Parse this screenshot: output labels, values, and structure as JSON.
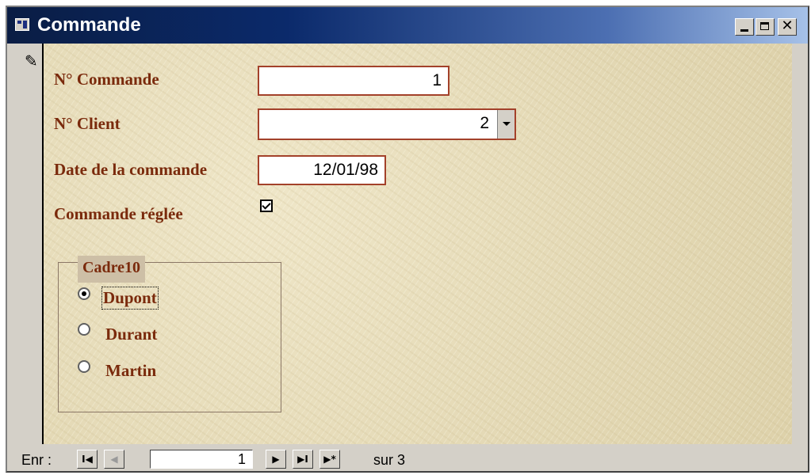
{
  "window": {
    "title": "Commande",
    "close_glyph": "✕"
  },
  "record_selector": {
    "icon": "pencil-icon",
    "glyph": "✎"
  },
  "form": {
    "fields": {
      "order_no": {
        "label": "N° Commande",
        "value": "1"
      },
      "client_no": {
        "label": "N° Client",
        "value": "2"
      },
      "order_date": {
        "label": "Date de la commande",
        "value": "12/01/98"
      },
      "paid": {
        "label": "Commande réglée",
        "checked": true
      }
    },
    "group": {
      "title": "Cadre10",
      "options": [
        {
          "label": "Dupont",
          "selected": true
        },
        {
          "label": "Durant",
          "selected": false
        },
        {
          "label": "Martin",
          "selected": false
        }
      ]
    }
  },
  "navigation": {
    "label": "Enr :",
    "first_glyph": "⏮",
    "first_text": "I◀",
    "prev_text": "◀",
    "next_text": "▶",
    "last_text": "▶I",
    "new_text": "▶*",
    "current_record": "1",
    "total_text": "sur  3"
  },
  "colors": {
    "label_text": "#7a2a0c",
    "field_border": "#a3412a",
    "form_background": "#e6dcbb",
    "titlebar_start": "#0a1d44",
    "titlebar_end": "#a6c1e8"
  }
}
